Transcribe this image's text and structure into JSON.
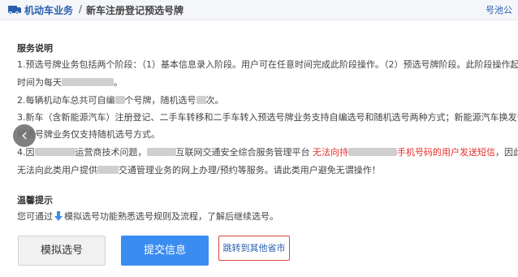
{
  "header": {
    "main": "机动车业务",
    "separator": "/",
    "sub": "新车注册登记预选号牌",
    "right": "号池公"
  },
  "service": {
    "title": "服务说明",
    "p1_line1": "1.预选号牌业务包括两个阶段：（1）基本信息录入阶段。用户可在任意时间完成此阶段操作。（2）预选号牌阶段。此阶段操作起止",
    "p1_line2_a": "时间为每天",
    "p1_line2_b": "。",
    "p2_a": "2.每辆机动车总共可自编",
    "p2_b": "个号牌，随机选号",
    "p2_c": "次。",
    "p3_line1": "3.新车（含新能源汽车）注册登记、二手车转移和二手车转入预选号牌业务支持自编选号和随机选号两种方式；新能源汽车换发号牌",
    "p3_line2": "预选号牌业务仅支持随机选号方式。",
    "p4_a": "4.因",
    "p4_b": "运营商技术问题，",
    "p4_c": "互联网交通安全综合服务管理平台",
    "p4_red_a": "无法向持",
    "p4_red_b": "手机号码的用户发送短信",
    "p4_d": "，因此",
    "p4_line2_a": "无法向此类用户提供",
    "p4_line2_b": "交通管理业务的网上办理/预约等服务。请此类用户避免无谓操作！"
  },
  "tips": {
    "title": "温馨提示",
    "text_a": "您可通过",
    "text_b": "模拟选号功能熟悉选号规则及流程，了解后继续选号。"
  },
  "buttons": {
    "simulate": "模拟选号",
    "submit": "提交信息",
    "other_province": "跳转到其他省市"
  },
  "icons": {
    "back": "chevron-left-icon",
    "hint": "arrow-down-icon",
    "header": "truck-icon"
  },
  "colors": {
    "brand_blue": "#2b5fae",
    "submit_blue": "#3b8cf0",
    "warning_red": "#e0302b"
  }
}
